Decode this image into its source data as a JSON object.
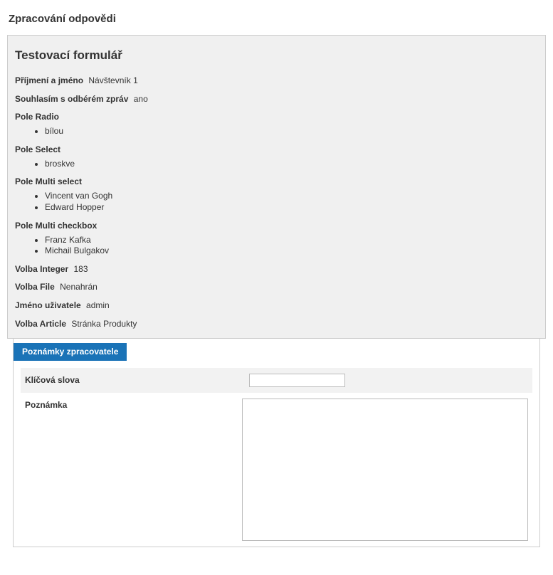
{
  "page": {
    "title": "Zpracování odpovědi"
  },
  "panel": {
    "title": "Testovací formulář",
    "fields": {
      "name_label": "Příjmení a jméno",
      "name_value": "Návštevník 1",
      "consent_label": "Souhlasím s odbérém zpráv",
      "consent_value": "ano",
      "radio_label": "Pole Radio",
      "radio_values": [
        "bílou"
      ],
      "select_label": "Pole Select",
      "select_values": [
        "broskve"
      ],
      "multiselect_label": "Pole Multi select",
      "multiselect_values": [
        "Vincent van Gogh",
        "Edward Hopper"
      ],
      "multicheckbox_label": "Pole Multi checkbox",
      "multicheckbox_values": [
        "Franz Kafka",
        "Michail Bulgakov"
      ],
      "integer_label": "Volba Integer",
      "integer_value": "183",
      "file_label": "Volba File",
      "file_value": "Nenahrán",
      "username_label": "Jméno uživatele",
      "username_value": "admin",
      "article_label": "Volba Article",
      "article_value": "Stránka Produkty"
    }
  },
  "notes": {
    "tab_label": "Poznámky zpracovatele",
    "keywords_label": "Klíčová slova",
    "keywords_value": "",
    "note_label": "Poznámka",
    "note_value": ""
  }
}
